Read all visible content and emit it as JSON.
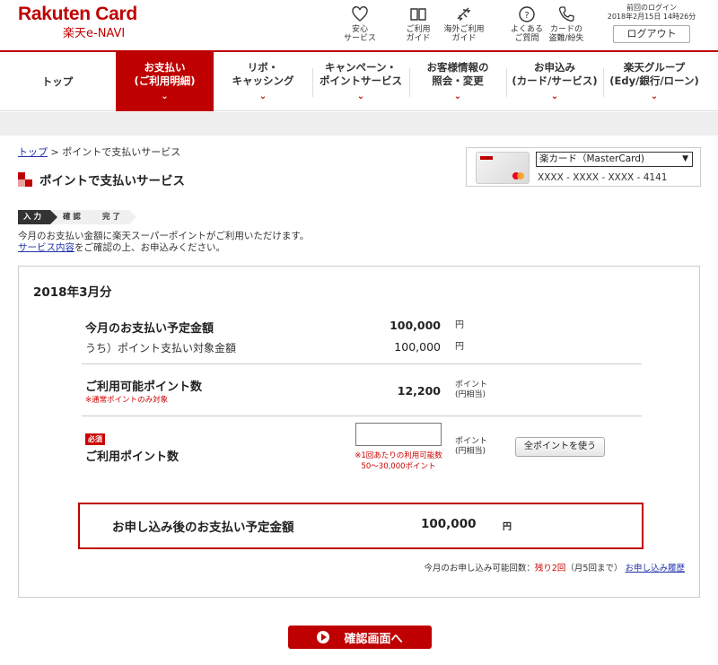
{
  "header": {
    "brand": "Rakuten Card",
    "sub": "楽天e-NAVI",
    "icons": [
      {
        "name": "heart-icon",
        "l1": "安心",
        "l2": "サービス"
      },
      {
        "name": "book-icon",
        "l1": "ご利用",
        "l2": "ガイド"
      },
      {
        "name": "airplane-icon",
        "l1": "海外ご利用",
        "l2": "ガイド"
      },
      {
        "name": "question-icon",
        "l1": "よくある",
        "l2": "ご質問"
      },
      {
        "name": "phone-icon",
        "l1": "カードの",
        "l2": "盗難/紛失"
      }
    ],
    "login_label": "前回のログイン",
    "login_time": "2018年2月15日 14時26分",
    "logout": "ログアウト"
  },
  "nav": [
    {
      "l1": "トップ",
      "l2": ""
    },
    {
      "l1": "お支払い",
      "l2": "(ご利用明細)"
    },
    {
      "l1": "リボ・",
      "l2": "キャッシング"
    },
    {
      "l1": "キャンペーン・",
      "l2": "ポイントサービス"
    },
    {
      "l1": "お客様情報の",
      "l2": "照会・変更"
    },
    {
      "l1": "お申込み",
      "l2": "(カード/サービス)"
    },
    {
      "l1": "楽天グループ",
      "l2": "(Edy/銀行/ローン)"
    }
  ],
  "breadcrumb": {
    "home": "トップ",
    "sep": " > ",
    "current": "ポイントで支払いサービス"
  },
  "page_title": "ポイントで支払いサービス",
  "card": {
    "selected": "楽カード（MasterCard)",
    "number": "XXXX - XXXX - XXXX - 4141"
  },
  "steps": [
    "入 力",
    "確 認",
    "完 了"
  ],
  "desc": {
    "line1": "今月のお支払い金額に楽天スーパーポイントがご利用いただけます。",
    "link": "サービス内容",
    "line2": "をご確認の上、お申込みください。"
  },
  "main": {
    "month": "2018年3月分",
    "due_label": "今月のお支払い予定金額",
    "due_value": "100,000",
    "due_unit": "円",
    "target_label": "うち）ポイント支払い対象金額",
    "target_value": "100,000",
    "target_unit": "円",
    "avail_label": "ご利用可能ポイント数",
    "avail_note": "※通常ポイントのみ対象",
    "avail_value": "12,200",
    "avail_unit1": "ポイント",
    "avail_unit2": "(円相当)",
    "required": "必須",
    "use_label": "ご利用ポイント数",
    "input_value": "",
    "input_note1": "※1回あたりの利用可能数",
    "input_note2": "50〜30,000ポイント",
    "use_unit1": "ポイント",
    "use_unit2": "(円相当)",
    "all_points": "全ポイントを使う",
    "total_label": "お申し込み後のお支払い予定金額",
    "total_value": "100,000",
    "total_unit": "円",
    "foot_prefix": "今月のお申し込み可能回数：",
    "foot_remain": "残り2回",
    "foot_suffix": "（月5回まで）",
    "foot_link": "お申し込み履歴"
  },
  "confirm_button": "確認画面へ",
  "colors": {
    "brand": "#bf0000",
    "link": "#2233aa"
  }
}
